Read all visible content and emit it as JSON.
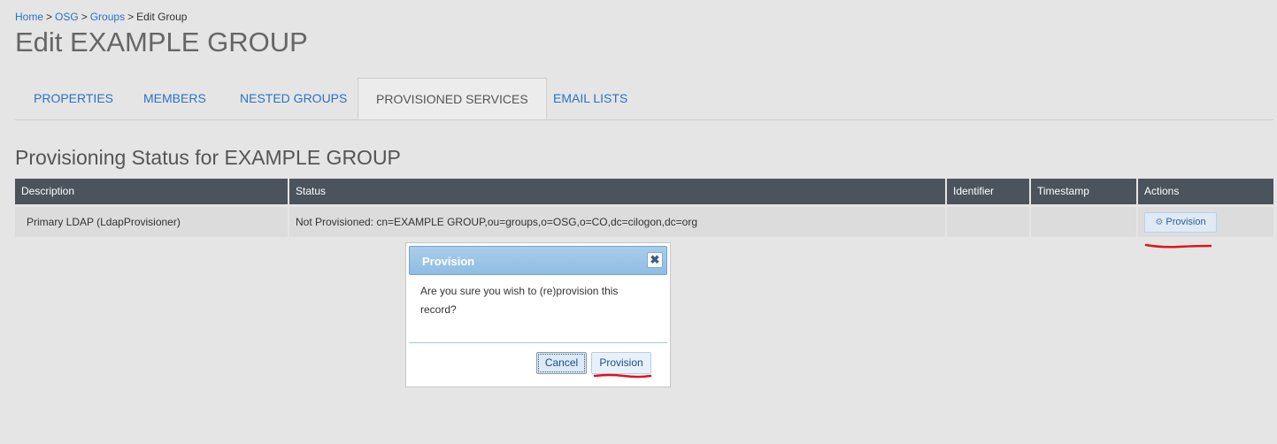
{
  "breadcrumb": {
    "items": [
      "Home",
      "OSG",
      "Groups"
    ],
    "separator": ">",
    "current": "Edit Group"
  },
  "page_title": "Edit EXAMPLE GROUP",
  "tabs": [
    {
      "label": "PROPERTIES",
      "active": false
    },
    {
      "label": "MEMBERS",
      "active": false
    },
    {
      "label": "NESTED GROUPS",
      "active": false
    },
    {
      "label": "PROVISIONED SERVICES",
      "active": true
    },
    {
      "label": "EMAIL LISTS",
      "active": false
    }
  ],
  "section_title": "Provisioning Status for EXAMPLE GROUP",
  "table": {
    "headers": [
      "Description",
      "Status",
      "Identifier",
      "Timestamp",
      "Actions"
    ],
    "rows": [
      {
        "description": "Primary LDAP (LdapProvisioner)",
        "status": "Not Provisioned: cn=EXAMPLE GROUP,ou=groups,o=OSG,o=CO,dc=cilogon,dc=org",
        "identifier": "",
        "timestamp": "",
        "action_label": "Provision",
        "action_icon": "gear-icon"
      }
    ]
  },
  "dialog": {
    "title": "Provision",
    "close_icon": "close-icon",
    "message": "Are you sure you wish to (re)provision this record?",
    "cancel_label": "Cancel",
    "confirm_label": "Provision"
  },
  "colors": {
    "link": "#2a72c4",
    "table_header_bg": "#4b535c",
    "annotation": "#e0121c",
    "dialog_titlebar": "#9cc5e6"
  }
}
